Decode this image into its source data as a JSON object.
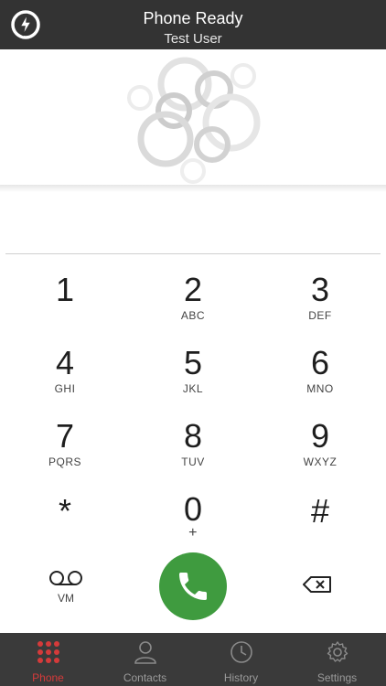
{
  "header": {
    "title": "Phone Ready",
    "subtitle": "Test User"
  },
  "dialer": {
    "number": "",
    "keys": [
      {
        "digit": "1",
        "letters": ""
      },
      {
        "digit": "2",
        "letters": "ABC"
      },
      {
        "digit": "3",
        "letters": "DEF"
      },
      {
        "digit": "4",
        "letters": "GHI"
      },
      {
        "digit": "5",
        "letters": "JKL"
      },
      {
        "digit": "6",
        "letters": "MNO"
      },
      {
        "digit": "7",
        "letters": "PQRS"
      },
      {
        "digit": "8",
        "letters": "TUV"
      },
      {
        "digit": "9",
        "letters": "WXYZ"
      },
      {
        "digit": "*",
        "letters": ""
      },
      {
        "digit": "0",
        "letters": "+"
      },
      {
        "digit": "#",
        "letters": ""
      }
    ],
    "voicemail_label": "VM"
  },
  "tabs": [
    {
      "label": "Phone",
      "icon": "dialpad-icon",
      "active": true
    },
    {
      "label": "Contacts",
      "icon": "contacts-icon",
      "active": false
    },
    {
      "label": "History",
      "icon": "history-icon",
      "active": false
    },
    {
      "label": "Settings",
      "icon": "gear-icon",
      "active": false
    }
  ],
  "colors": {
    "header_bg": "#333333",
    "call_green": "#3f9b3f",
    "tab_active": "#d53a3a",
    "tab_inactive": "#9a9a9a"
  }
}
